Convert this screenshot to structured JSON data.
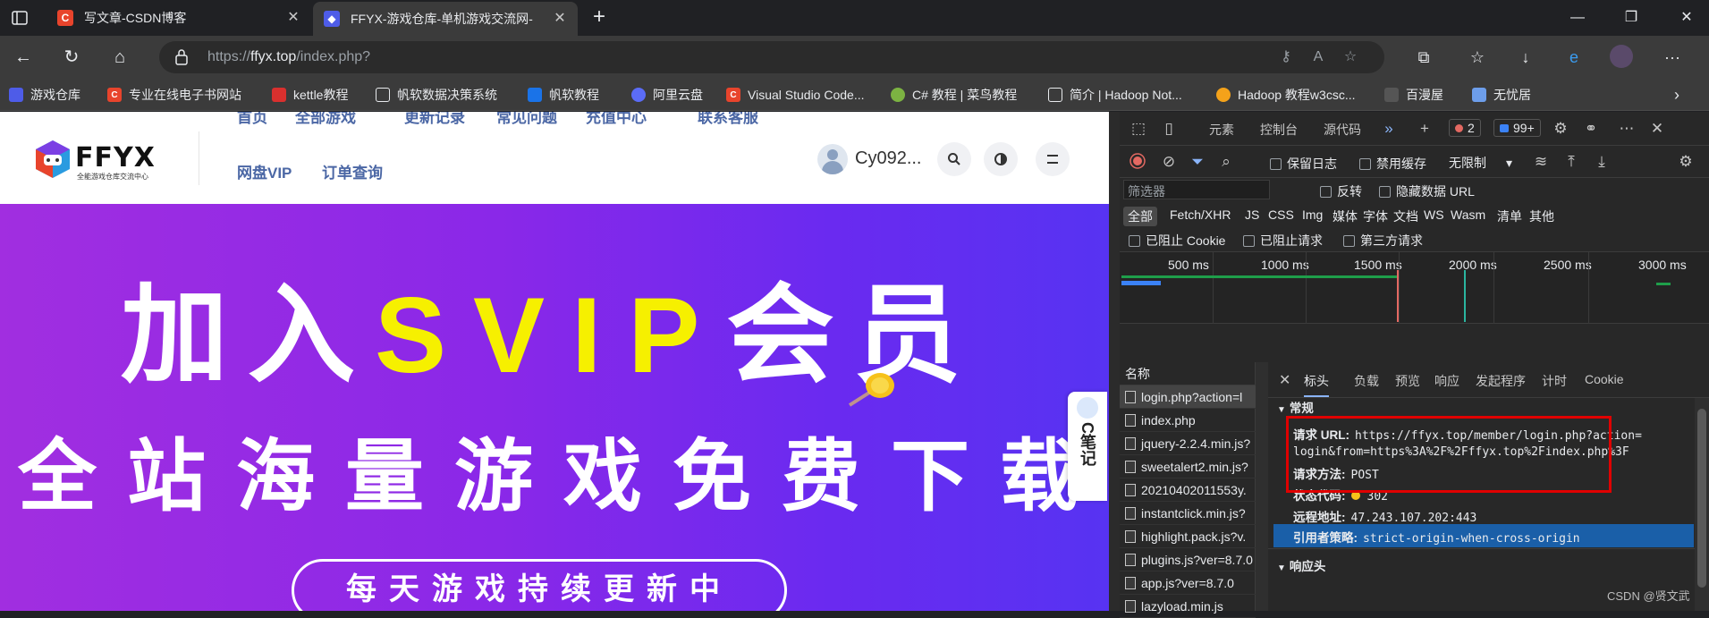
{
  "browser": {
    "tabs": [
      {
        "label": "写文章-CSDN博客",
        "favicon_letter": "C",
        "favicon_color": "#e8442c"
      },
      {
        "label": "FFYX-游戏仓库-单机游戏交流网-",
        "favicon_letter": "",
        "favicon_color": "#4e5ce8"
      }
    ],
    "url_prefix": "https://",
    "url_domain": "ffyx.top",
    "url_path": "/index.php?"
  },
  "bookmarks": [
    {
      "label": "游戏仓库",
      "color": "#4e5ce8",
      "letter": ""
    },
    {
      "label": "专业在线电子书网站",
      "color": "#e8442c",
      "letter": "C"
    },
    {
      "label": "kettle教程",
      "color": "#d9302e",
      "letter": ""
    },
    {
      "label": "帆软数据决策系统",
      "color": "#3b3b3b",
      "letter": ""
    },
    {
      "label": "帆软教程",
      "color": "#1a73e8",
      "letter": ""
    },
    {
      "label": "阿里云盘",
      "color": "#5b6cf7",
      "letter": ""
    },
    {
      "label": "Visual Studio Code...",
      "color": "#e8442c",
      "letter": "C"
    },
    {
      "label": "C# 教程 | 菜鸟教程",
      "color": "#7cb342",
      "letter": ""
    },
    {
      "label": "简介 | Hadoop Not...",
      "color": "#3b3b3b",
      "letter": ""
    },
    {
      "label": "Hadoop 教程w3csc...",
      "color": "#f4a21a",
      "letter": ""
    },
    {
      "label": "百漫屋",
      "color": "#3b3b3b",
      "letter": ""
    },
    {
      "label": "无忧居",
      "color": "#6d9eeb",
      "letter": ""
    }
  ],
  "site": {
    "logo_text": "FFYX",
    "logo_sub": "全能游戏仓库交流中心",
    "nav_top": [
      "首页",
      "全部游戏",
      "更新记录",
      "常见问题",
      "充值中心",
      "联系客服"
    ],
    "nav_bottom": [
      "网盘VIP",
      "订单查询"
    ],
    "user_name": "Cy092...",
    "banner_line1_a": "加入",
    "banner_line1_svip": "SVIP",
    "banner_line1_b": "会员",
    "banner_line2": "全站海量游戏免费下载",
    "banner_pill": "每天游戏持续更新中",
    "side_note": "C笔记"
  },
  "devtools": {
    "tabs": [
      "元素",
      "控制台",
      "源代码"
    ],
    "error_count": "2",
    "msg_count": "99+",
    "preserve_log": "保留日志",
    "disable_cache": "禁用缓存",
    "throttle": "无限制",
    "filter_placeholder": "筛选器",
    "invert": "反转",
    "hide_data_url": "隐藏数据 URL",
    "type_filters": [
      "全部",
      "Fetch/XHR",
      "JS",
      "CSS",
      "Img",
      "媒体",
      "字体",
      "文档",
      "WS",
      "Wasm",
      "清单",
      "其他"
    ],
    "blocked_cookies": "已阻止 Cookie",
    "blocked_requests": "已阻止请求",
    "third_party": "第三方请求",
    "timeline_ticks": [
      "500 ms",
      "1000 ms",
      "1500 ms",
      "2000 ms",
      "2500 ms",
      "3000 ms"
    ],
    "name_col": "名称",
    "requests": [
      "login.php?action=l",
      "index.php",
      "jquery-2.2.4.min.js?",
      "sweetalert2.min.js?",
      "20210402011553y.",
      "instantclick.min.js?",
      "highlight.pack.js?v.",
      "plugins.js?ver=8.7.0",
      "app.js?ver=8.7.0",
      "lazyload.min.js"
    ],
    "detail_tabs": [
      "标头",
      "负载",
      "预览",
      "响应",
      "发起程序",
      "计时",
      "Cookie"
    ],
    "general_section": "常规",
    "request_url_key": "请求 URL:",
    "request_url_val1": "https://ffyx.top/member/login.php?action=",
    "request_url_val2": "login&from=https%3A%2F%2Fffyx.top%2Findex.php%3F",
    "method_key": "请求方法:",
    "method_val": "POST",
    "status_key": "状态代码:",
    "status_val": "302",
    "remote_key": "远程地址:",
    "remote_val": "47.243.107.202:443",
    "referrer_key": "引用者策略:",
    "referrer_val": "strict-origin-when-cross-origin",
    "response_section": "响应头"
  },
  "watermark": "CSDN @贤文武"
}
